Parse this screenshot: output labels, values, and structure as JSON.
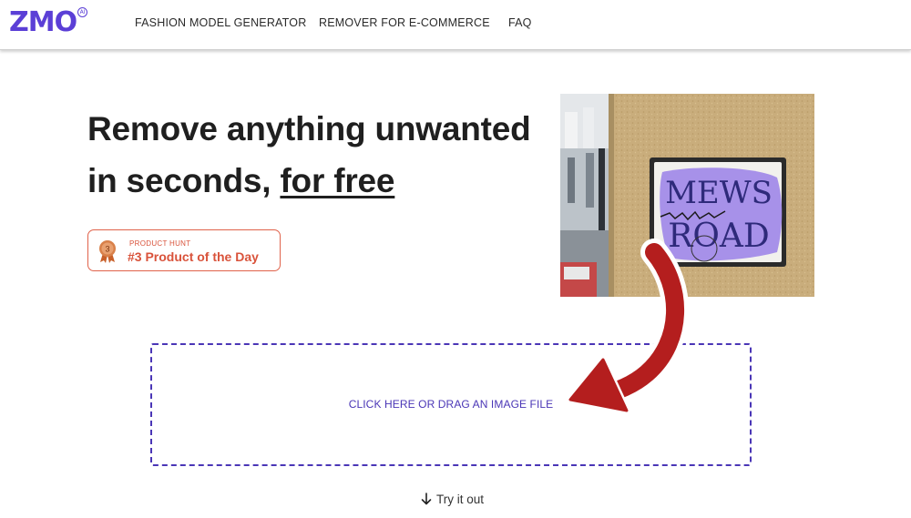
{
  "header": {
    "logo_text": "ZMO",
    "logo_badge": "AI",
    "nav": [
      {
        "label": "FASHION MODEL GENERATOR"
      },
      {
        "label": "REMOVER FOR E-COMMERCE"
      },
      {
        "label": "FAQ"
      }
    ]
  },
  "hero": {
    "line1_before": "Remove ",
    "line1_highlight": "anything",
    "line1_after": " unwanted",
    "line2_before": "in seconds, ",
    "line2_link": "for free",
    "badge": {
      "medal_number": "3",
      "small": "PRODUCT HUNT",
      "big": "#3 Product of the Day"
    }
  },
  "demo_image": {
    "sign_line1": "MEWS",
    "sign_line2": "ROAD"
  },
  "upload": {
    "label": "CLICK HERE OR DRAG AN IMAGE FILE"
  },
  "try_it": {
    "label": "Try it out"
  },
  "colors": {
    "brand": "#5b3fd6",
    "dropzone": "#4a36b6",
    "badge": "#e0624a",
    "highlight": "#a88cf0",
    "arrow": "#b41e1e"
  }
}
